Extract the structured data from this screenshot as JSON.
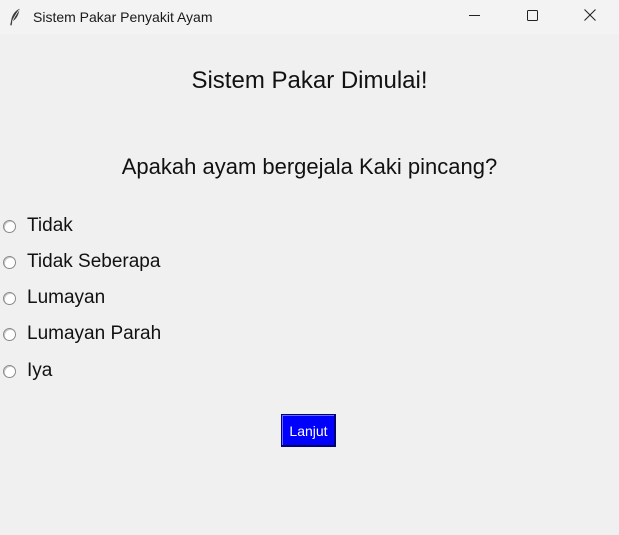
{
  "window": {
    "title": "Sistem Pakar Penyakit Ayam",
    "icon": "feather-icon",
    "controls": [
      "minimize-icon",
      "maximize-icon",
      "close-icon"
    ]
  },
  "main": {
    "heading": "Sistem Pakar Dimulai!",
    "question": "Apakah ayam bergejala Kaki pincang?",
    "options": [
      {
        "label": "Tidak",
        "selected": false
      },
      {
        "label": "Tidak Seberapa",
        "selected": false
      },
      {
        "label": "Lumayan",
        "selected": false
      },
      {
        "label": "Lumayan Parah",
        "selected": false
      },
      {
        "label": "Iya",
        "selected": false
      }
    ],
    "next_button": {
      "label": "Lanjut",
      "color": "#0000ff",
      "text_color": "#ffffff"
    }
  }
}
